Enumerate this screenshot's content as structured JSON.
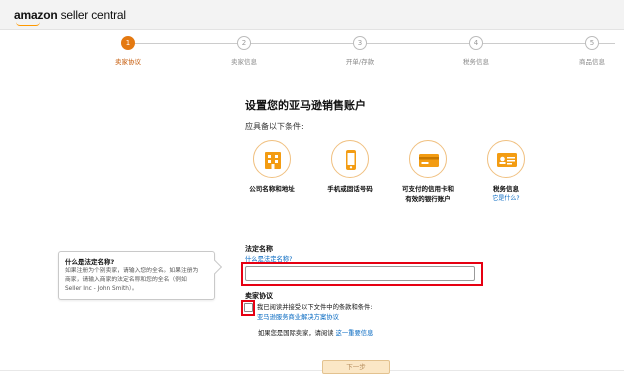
{
  "app": {
    "logo_amazon": "amazon",
    "logo_seller_central": "seller central"
  },
  "steps": [
    {
      "number": "1",
      "label": "卖家协议",
      "active": true
    },
    {
      "number": "2",
      "label": "卖家信息",
      "active": false
    },
    {
      "number": "3",
      "label": "开单/存款",
      "active": false
    },
    {
      "number": "4",
      "label": "税务信息",
      "active": false
    },
    {
      "number": "5",
      "label": "商品信息",
      "active": false
    }
  ],
  "main": {
    "title": "设置您的亚马逊销售账户",
    "subtitle": "应具备以下条件:"
  },
  "requirements": [
    {
      "icon": "building-icon",
      "label_line1": "公司名称和地址",
      "label_line2": ""
    },
    {
      "icon": "phone-icon",
      "label_line1": "手机或固话号码",
      "label_line2": ""
    },
    {
      "icon": "credit-card-icon",
      "label_line1": "可支付的信用卡和",
      "label_line2": "有效的银行账户"
    },
    {
      "icon": "id-card-icon",
      "label_line1": "税务信息",
      "label_line2": "",
      "link": "它是什么?"
    }
  ],
  "tooltip": {
    "title": "什么是法定名称?",
    "body_line1": "如果注册为个别卖家，请输入您的全名。如果注册为",
    "body_line2": "商家，请输入商家的法定名称和您的全名（例如",
    "body_line3": "Seller Inc - John Smith）。"
  },
  "legal_name": {
    "label": "法定名称",
    "help_link": "什么是法定名称?",
    "value": "",
    "placeholder": ""
  },
  "agreement": {
    "label": "卖家协议",
    "checkbox_text": "我已阅读并接受以下文件中的条款和条件:",
    "link": "亚马逊服务商业解决方案协议",
    "checked": false
  },
  "international": {
    "text": "如果您是国际卖家，请阅读",
    "link": "这一重要信息"
  },
  "next_button": {
    "label": "下一步"
  },
  "colors": {
    "accent": "#e47911",
    "link": "#0066c0",
    "highlight_border": "#e60012"
  }
}
